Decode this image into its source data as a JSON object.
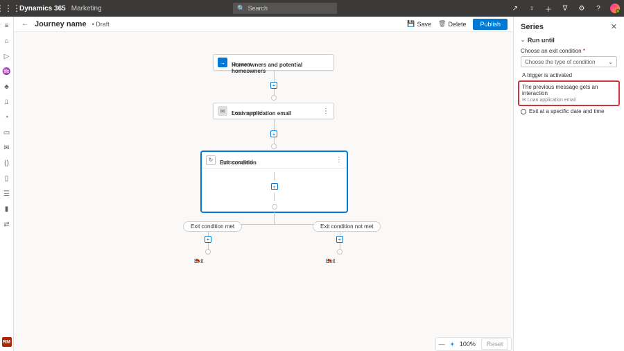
{
  "navbar": {
    "brand": "Dynamics 365",
    "subbrand": "Marketing",
    "search_placeholder": "Search"
  },
  "cmd": {
    "journey_name": "Journey name",
    "status": "Draft",
    "save": "Save",
    "delete": "Delete",
    "publish": "Publish"
  },
  "canvas": {
    "segment": {
      "label": "Segment",
      "value": "Homeowners and potential homeowners"
    },
    "email": {
      "label": "Send an email",
      "value": "Loan application email"
    },
    "series": {
      "label": "Run series until",
      "value": "Exit condition"
    },
    "branch_met": "Exit condition met",
    "branch_not_met": "Exit condition not met",
    "exit": "Exit"
  },
  "zoom": {
    "percent": "100%",
    "reset": "Reset"
  },
  "panel": {
    "title": "Series",
    "section": "Run until",
    "choose_label": "Choose an exit condition",
    "choose_placeholder": "Choose the type of condition",
    "opt_trigger": "A trigger is activated",
    "highlight_title": "The previous message gets an interaction",
    "highlight_sub": "Loan application email",
    "opt_time": "Exit at a specific date and time"
  },
  "leftrail_badge": "RM"
}
